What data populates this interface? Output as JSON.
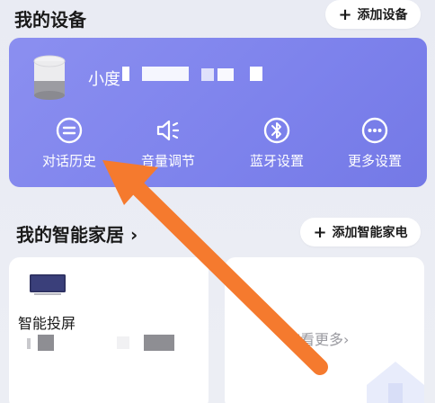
{
  "my_devices": {
    "title": "我的设备",
    "add_button_label": "添加设备"
  },
  "device_card": {
    "device_name": "小度",
    "actions": [
      {
        "label": "对话历史",
        "icon": "chat-bubble-icon"
      },
      {
        "label": "音量调节",
        "icon": "volume-icon"
      },
      {
        "label": "蓝牙设置",
        "icon": "bluetooth-icon"
      },
      {
        "label": "更多设置",
        "icon": "more-icon"
      }
    ]
  },
  "smart_home": {
    "title": "我的智能家居",
    "add_button_label": "添加智能家电",
    "devices": [
      {
        "name": "智能投屏",
        "icon": "tv-icon"
      }
    ],
    "view_more_label": "查看更多"
  },
  "colors": {
    "card_gradient": "#8b8ff0",
    "annotation_arrow": "#f57a2e"
  }
}
